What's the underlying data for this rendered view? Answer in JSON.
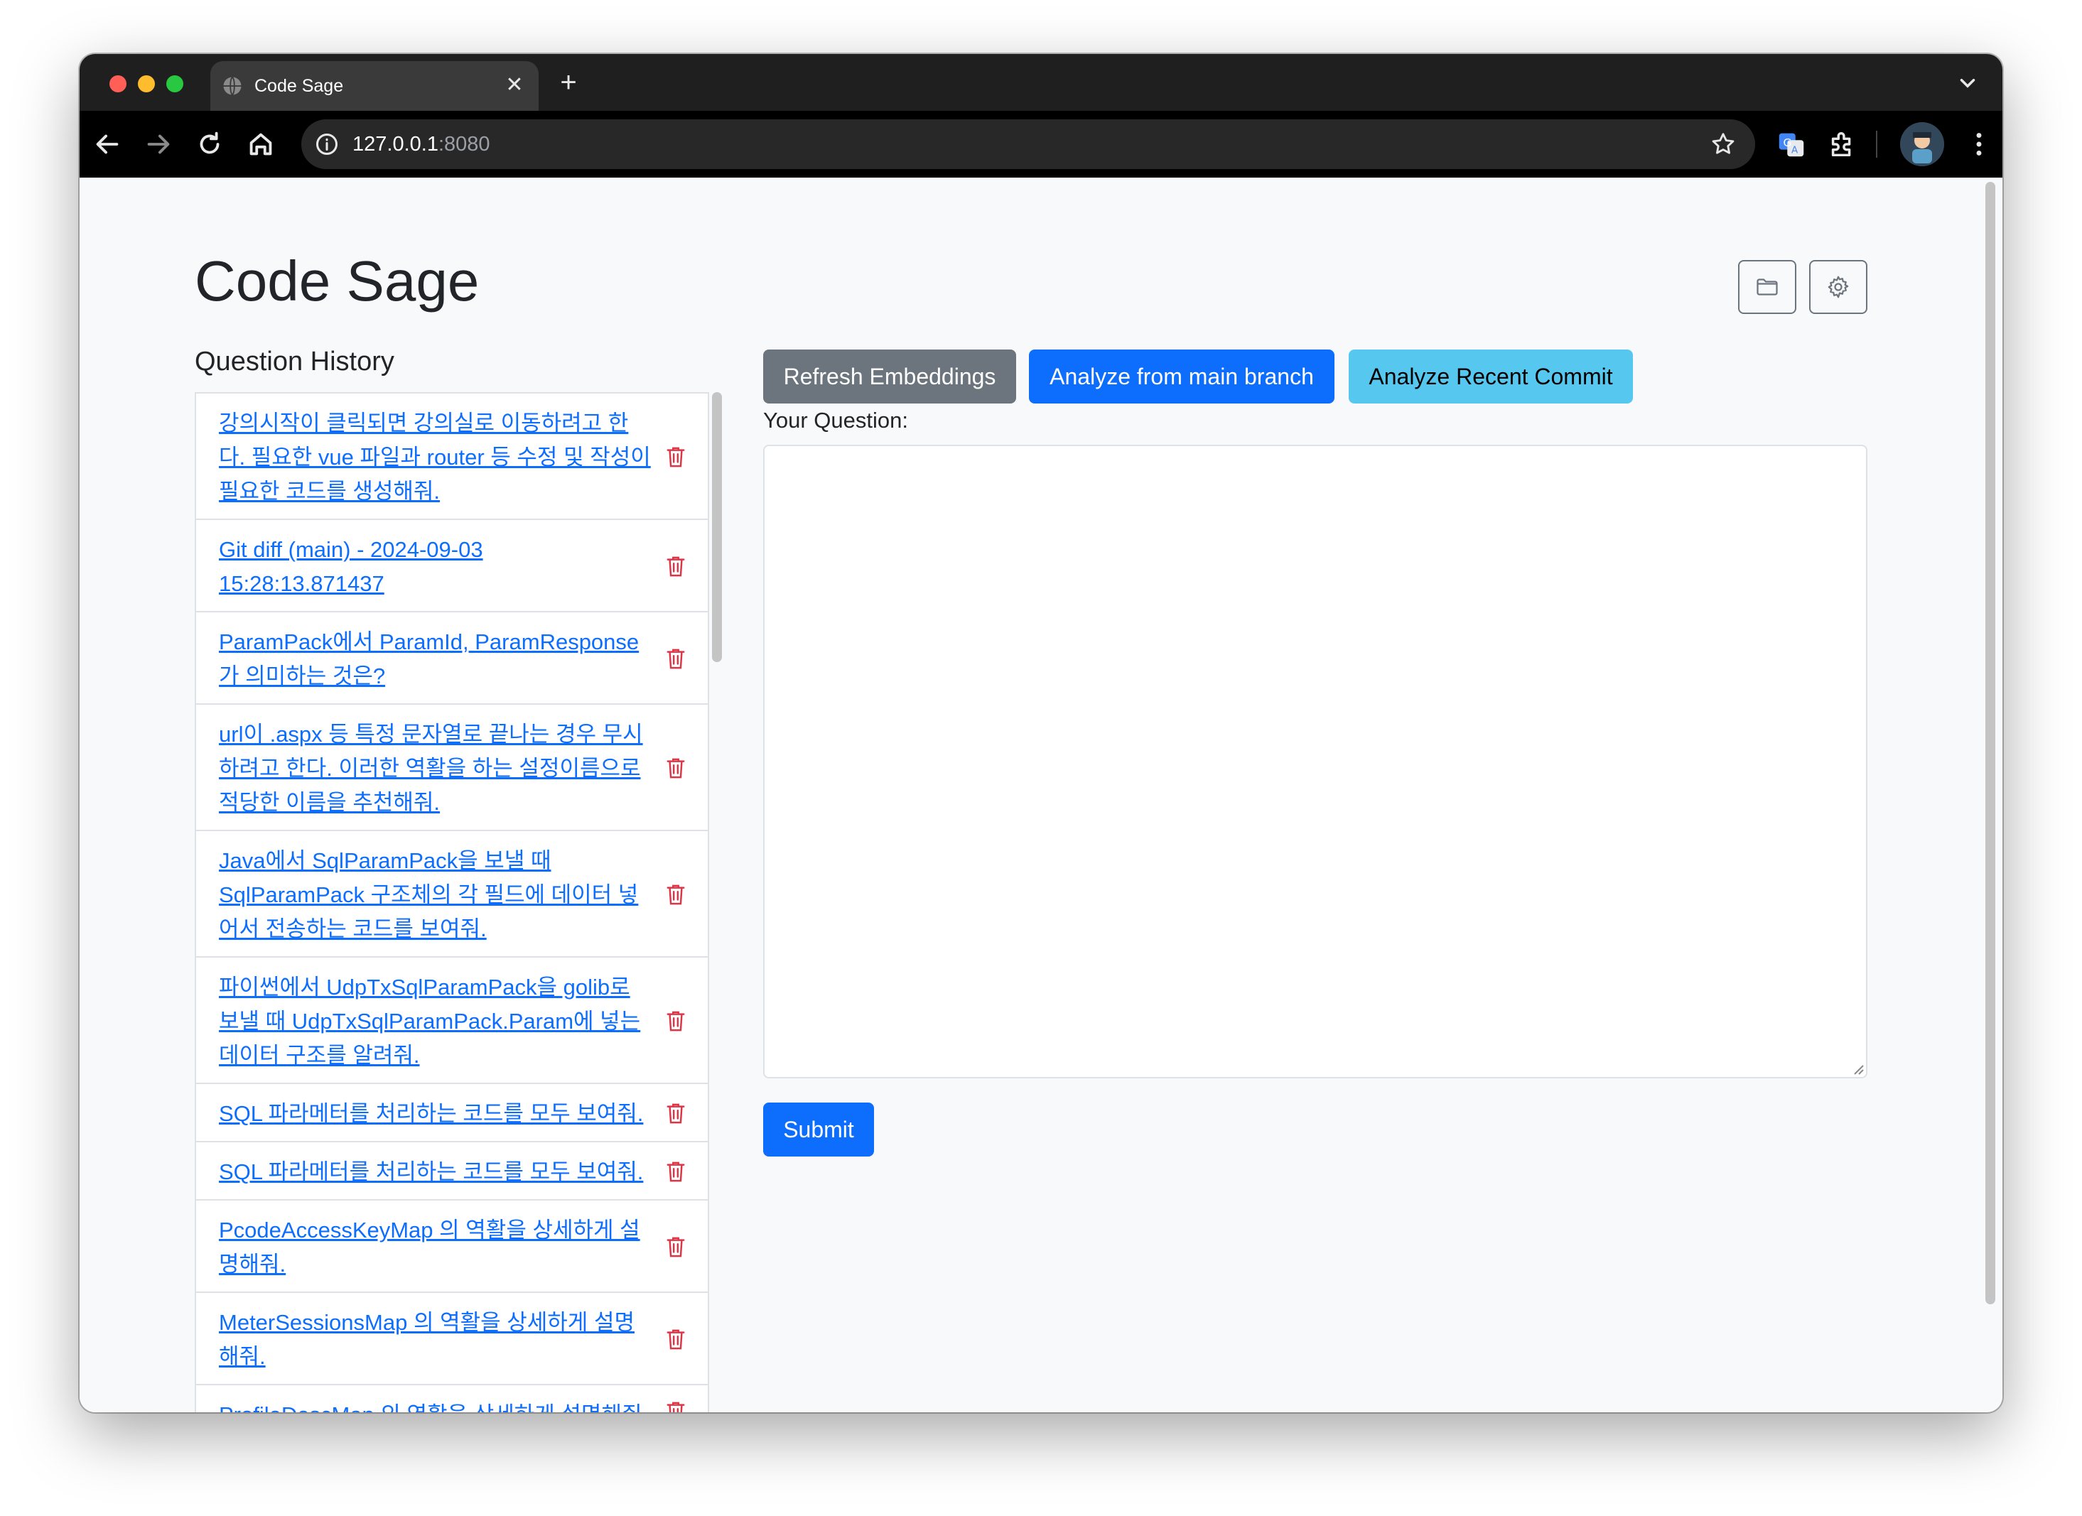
{
  "browser": {
    "tab_title": "Code Sage",
    "url_host": "127.0.0.1",
    "url_port": ":8080"
  },
  "page": {
    "title": "Code Sage",
    "history_title": "Question History",
    "question_label": "Your Question:",
    "question_value": ""
  },
  "actions": {
    "refresh": "Refresh Embeddings",
    "analyze_main": "Analyze from main branch",
    "analyze_commit": "Analyze Recent Commit",
    "submit": "Submit"
  },
  "history": [
    "강의시작이 클릭되면 강의실로 이동하려고 한다. 필요한 vue 파일과 router 등 수정 및 작성이 필요한 코드를 생성해줘.",
    "Git diff (main) - 2024-09-03 15:28:13.871437",
    "ParamPack에서 ParamId, ParamResponse가 의미하는 것은?",
    "url이 .aspx 등 특정 문자열로 끝나는 경우 무시하려고 한다. 이러한 역활을 하는 설정이름으로 적당한 이름을 추천해줘.",
    "Java에서 SqlParamPack을 보낼 때 SqlParamPack 구조체의 각 필드에 데이터 넣어서 전송하는 코드를 보여줘.",
    "파이썬에서 UdpTxSqlParamPack을 golib로 보낼 때 UdpTxSqlParamPack.Param에 넣는 데이터 구조를 알려줘.",
    "SQL 파라메터를 처리하는 코드를 모두 보여줘.",
    "SQL 파라메터를 처리하는 코드를 모두 보여줘.",
    "PcodeAccessKeyMap 의 역활을 상세하게 설명해줘.",
    "MeterSessionsMap 의 역활을 상세하게 설명해줘.",
    "ProfileDescMap 의 역활을 상세하게 설명해줘."
  ],
  "colors": {
    "primary": "#0d6efd",
    "secondary": "#6c757d",
    "info": "#56c8f0",
    "danger": "#dc3545"
  }
}
